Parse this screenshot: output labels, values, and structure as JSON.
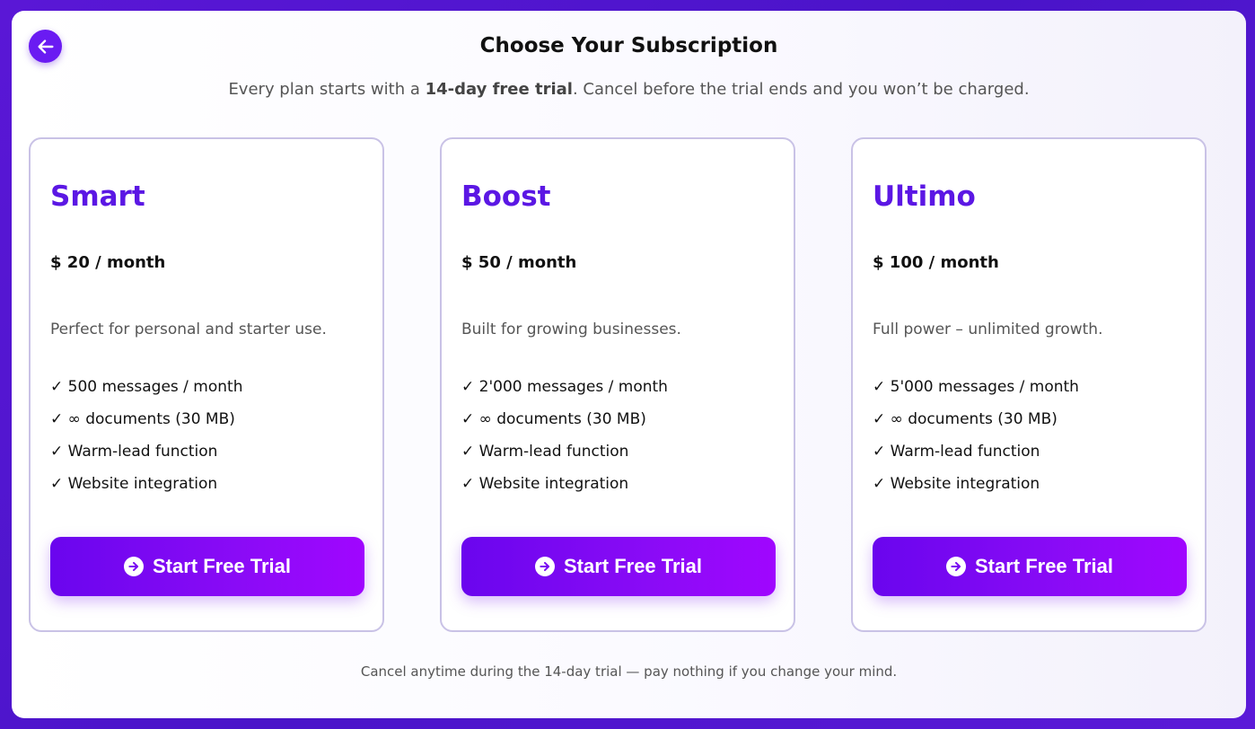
{
  "header": {
    "back_icon": "arrow-left-icon",
    "title": "Choose Your Subscription",
    "subtitle_pre": "Every plan starts with a ",
    "subtitle_bold": "14-day free trial",
    "subtitle_post": ". Cancel before the trial ends and you won’t be charged."
  },
  "plans": [
    {
      "name": "Smart",
      "price": "$ 20 / month",
      "description": "Perfect for personal and starter use.",
      "features": [
        "✓ 500 messages / month",
        "✓ ∞ documents (30 MB)",
        "✓ Warm-lead function",
        "✓ Website integration"
      ],
      "cta": "Start Free Trial"
    },
    {
      "name": "Boost",
      "price": "$ 50 / month",
      "description": "Built for growing businesses.",
      "features": [
        "✓ 2'000 messages / month",
        "✓ ∞ documents (30 MB)",
        "✓ Warm-lead function",
        "✓ Website integration"
      ],
      "cta": "Start Free Trial"
    },
    {
      "name": "Ultimo",
      "price": "$ 100 / month",
      "description": "Full power – unlimited growth.",
      "features": [
        "✓ 5'000 messages / month",
        "✓ ∞ documents (30 MB)",
        "✓ Warm-lead function",
        "✓ Website integration"
      ],
      "cta": "Start Free Trial"
    }
  ],
  "footer": {
    "note": "Cancel anytime during the 14-day trial — pay nothing if you change your mind."
  },
  "colors": {
    "accent": "#5b17e4",
    "button_start": "#6a05ee",
    "button_end": "#a006ff",
    "background": "#4a14c9"
  }
}
